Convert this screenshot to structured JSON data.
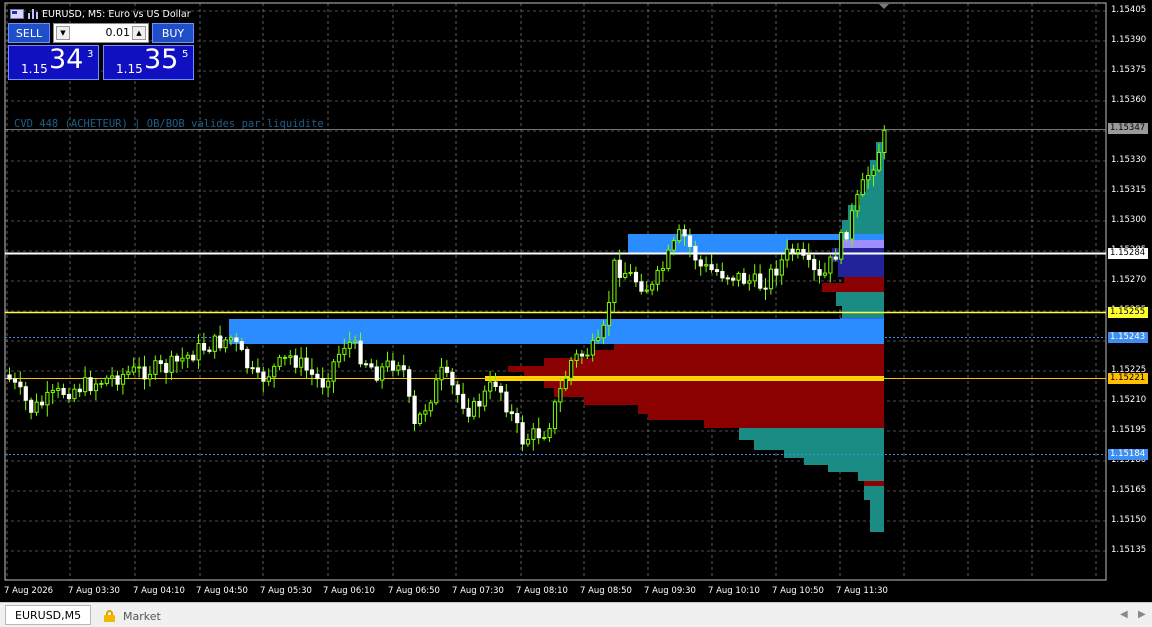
{
  "window": {
    "title": "EURUSD, M5:  Euro vs US Dollar"
  },
  "trade_panel": {
    "sell_label": "SELL",
    "buy_label": "BUY",
    "lot_value": "0.01",
    "bid": {
      "prefix": "1.15",
      "big": "34",
      "sup": "3"
    },
    "ask": {
      "prefix": "1.15",
      "big": "35",
      "sup": "5"
    },
    "down_icon": "triangle-down-icon",
    "up_icon": "triangle-up-icon"
  },
  "indicator_text": "CVD 448 (ACHETEUR) | OB/BOB valides par liquidite",
  "price_axis": {
    "ticks": [
      "1.15405",
      "1.15390",
      "1.15375",
      "1.15360",
      "1.15345",
      "1.15330",
      "1.15315",
      "1.15300",
      "1.15285",
      "1.15270",
      "1.15255",
      "1.15240",
      "1.15225",
      "1.15210",
      "1.15195",
      "1.15180",
      "1.15165",
      "1.15150",
      "1.15135"
    ],
    "current_price_tag": "1.15347",
    "level_tags": [
      {
        "label": "1.15284",
        "bg": "#ffffff"
      },
      {
        "label": "1.15255",
        "bg": "#ffff33"
      },
      {
        "label": "1.15243",
        "bg": "#3d8ef0"
      },
      {
        "label": "1.15221",
        "bg": "#ffc000"
      },
      {
        "label": "1.15184",
        "bg": "#3d8ef0"
      }
    ]
  },
  "time_axis": {
    "labels": [
      "7 Aug 2026",
      "7 Aug 03:30",
      "7 Aug 04:10",
      "7 Aug 04:50",
      "7 Aug 05:30",
      "7 Aug 06:10",
      "7 Aug 06:50",
      "7 Aug 07:30",
      "7 Aug 08:10",
      "7 Aug 08:50",
      "7 Aug 09:30",
      "7 Aug 10:10",
      "7 Aug 10:50",
      "7 Aug 11:30"
    ]
  },
  "colors": {
    "background": "#000000",
    "grid": "#9a9a9a",
    "bull_candle": "#7cfc00",
    "bear_candle": "#ffffff",
    "order_block": "#2a8cff",
    "volume_profile_sell": "#8b0000",
    "volume_profile_buy": "#1a8c84",
    "value_area": "#232399",
    "poc_line": "#ffd700"
  },
  "tabs": {
    "symbol_tab": "EURUSD,M5",
    "market_tab": "Market",
    "market_icon": "lock-icon",
    "scroll_left_icon": "chevron-left-icon",
    "scroll_right_icon": "chevron-right-icon"
  }
}
